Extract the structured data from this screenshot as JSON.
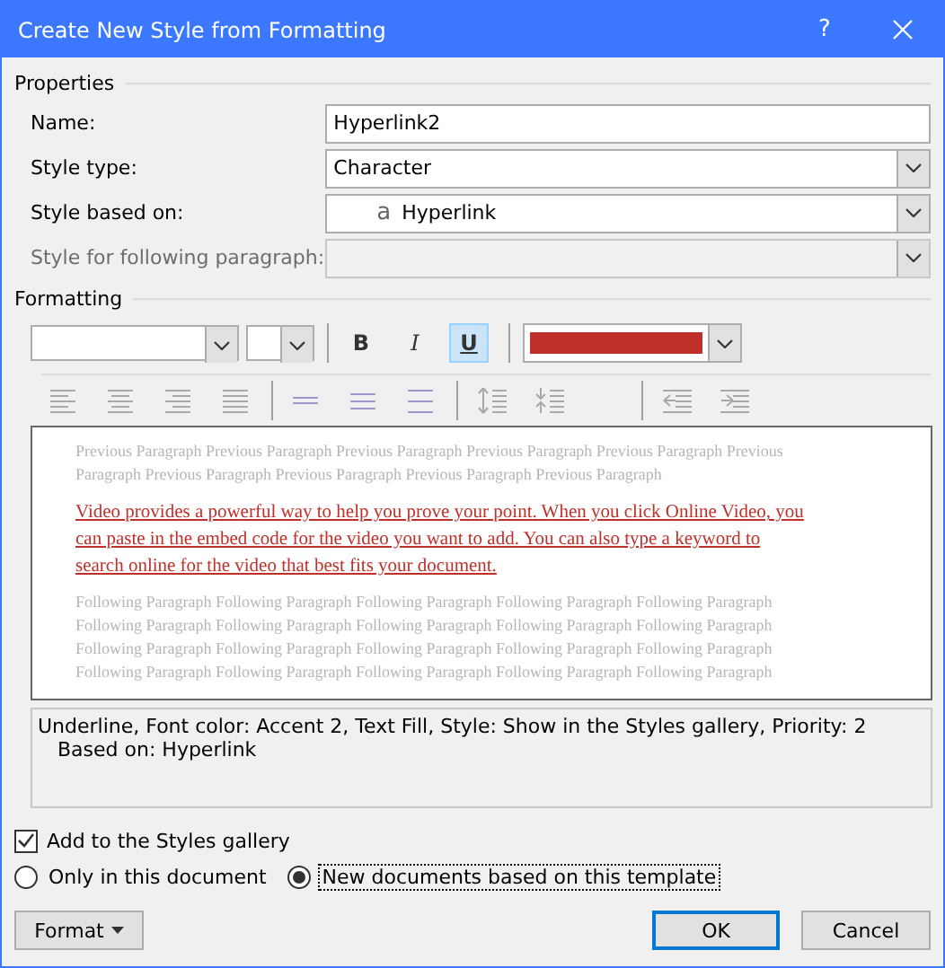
{
  "window": {
    "title": "Create New Style from Formatting",
    "help": "?"
  },
  "properties": {
    "heading": "Properties",
    "fields": [
      {
        "label": "Name:",
        "kind": "text",
        "value": "Hyperlink2",
        "disabled": false
      },
      {
        "label": "Style type:",
        "kind": "select",
        "value": "Character",
        "disabled": false
      },
      {
        "label": "Style based on:",
        "kind": "select",
        "prefix": "a",
        "value": "Hyperlink",
        "disabled": false
      },
      {
        "label": "Style for following paragraph:",
        "kind": "select",
        "disabled": true
      }
    ]
  },
  "formatting": {
    "heading": "Formatting",
    "styles": [
      {
        "label": "B",
        "kind": "bold",
        "selected": false
      },
      {
        "label": "I",
        "kind": "italic",
        "selected": false
      },
      {
        "label": "U",
        "kind": "underline",
        "selected": true
      }
    ],
    "font_color": {
      "color": "#c0302a"
    },
    "paragraph_buttons": [
      {
        "kind": "align-left",
        "disabled": true
      },
      {
        "kind": "align-center",
        "disabled": true
      },
      {
        "kind": "align-right",
        "disabled": true
      },
      {
        "kind": "justify",
        "disabled": true
      },
      {
        "kind": "sep"
      },
      {
        "kind": "spacing-single",
        "disabled": true
      },
      {
        "kind": "spacing-half",
        "disabled": true
      },
      {
        "kind": "spacing-double",
        "disabled": true
      },
      {
        "kind": "sep"
      },
      {
        "kind": "space-increase",
        "disabled": true
      },
      {
        "kind": "space-decrease",
        "disabled": true
      },
      {
        "kind": "gap"
      },
      {
        "kind": "sep"
      },
      {
        "kind": "indent-decrease",
        "disabled": true
      },
      {
        "kind": "indent-increase",
        "disabled": true
      }
    ]
  },
  "preview": {
    "previous": [
      "Previous Paragraph Previous Paragraph Previous Paragraph Previous Paragraph Previous Paragraph Previous",
      "Paragraph Previous Paragraph Previous Paragraph Previous Paragraph Previous Paragraph"
    ],
    "sample": [
      "Video provides a powerful way to help you prove your point. When you click Online Video, you",
      "can paste in the embed code for the video you want to add. You can also type a keyword to",
      "search online for the video that best fits your document."
    ],
    "following": [
      "Following Paragraph Following Paragraph Following Paragraph Following Paragraph Following Paragraph",
      "Following Paragraph Following Paragraph Following Paragraph Following Paragraph Following Paragraph",
      "Following Paragraph Following Paragraph Following Paragraph Following Paragraph Following Paragraph",
      "Following Paragraph Following Paragraph Following Paragraph Following Paragraph Following Paragraph"
    ]
  },
  "description": [
    "Underline, Font color: Accent 2, Text Fill, Style: Show in the Styles gallery, Priority: 2",
    "Based on: Hyperlink"
  ],
  "add_to_gallery": {
    "label": "Add to the Styles gallery",
    "checked": true
  },
  "scope": [
    {
      "label": "Only in this document",
      "selected": false,
      "focused": false
    },
    {
      "label": "New documents based on this template",
      "selected": true,
      "focused": true
    }
  ],
  "buttons": [
    {
      "label": "Format",
      "kind": "menu"
    },
    {
      "label": "OK",
      "kind": "default"
    },
    {
      "label": "Cancel",
      "kind": "normal"
    }
  ]
}
